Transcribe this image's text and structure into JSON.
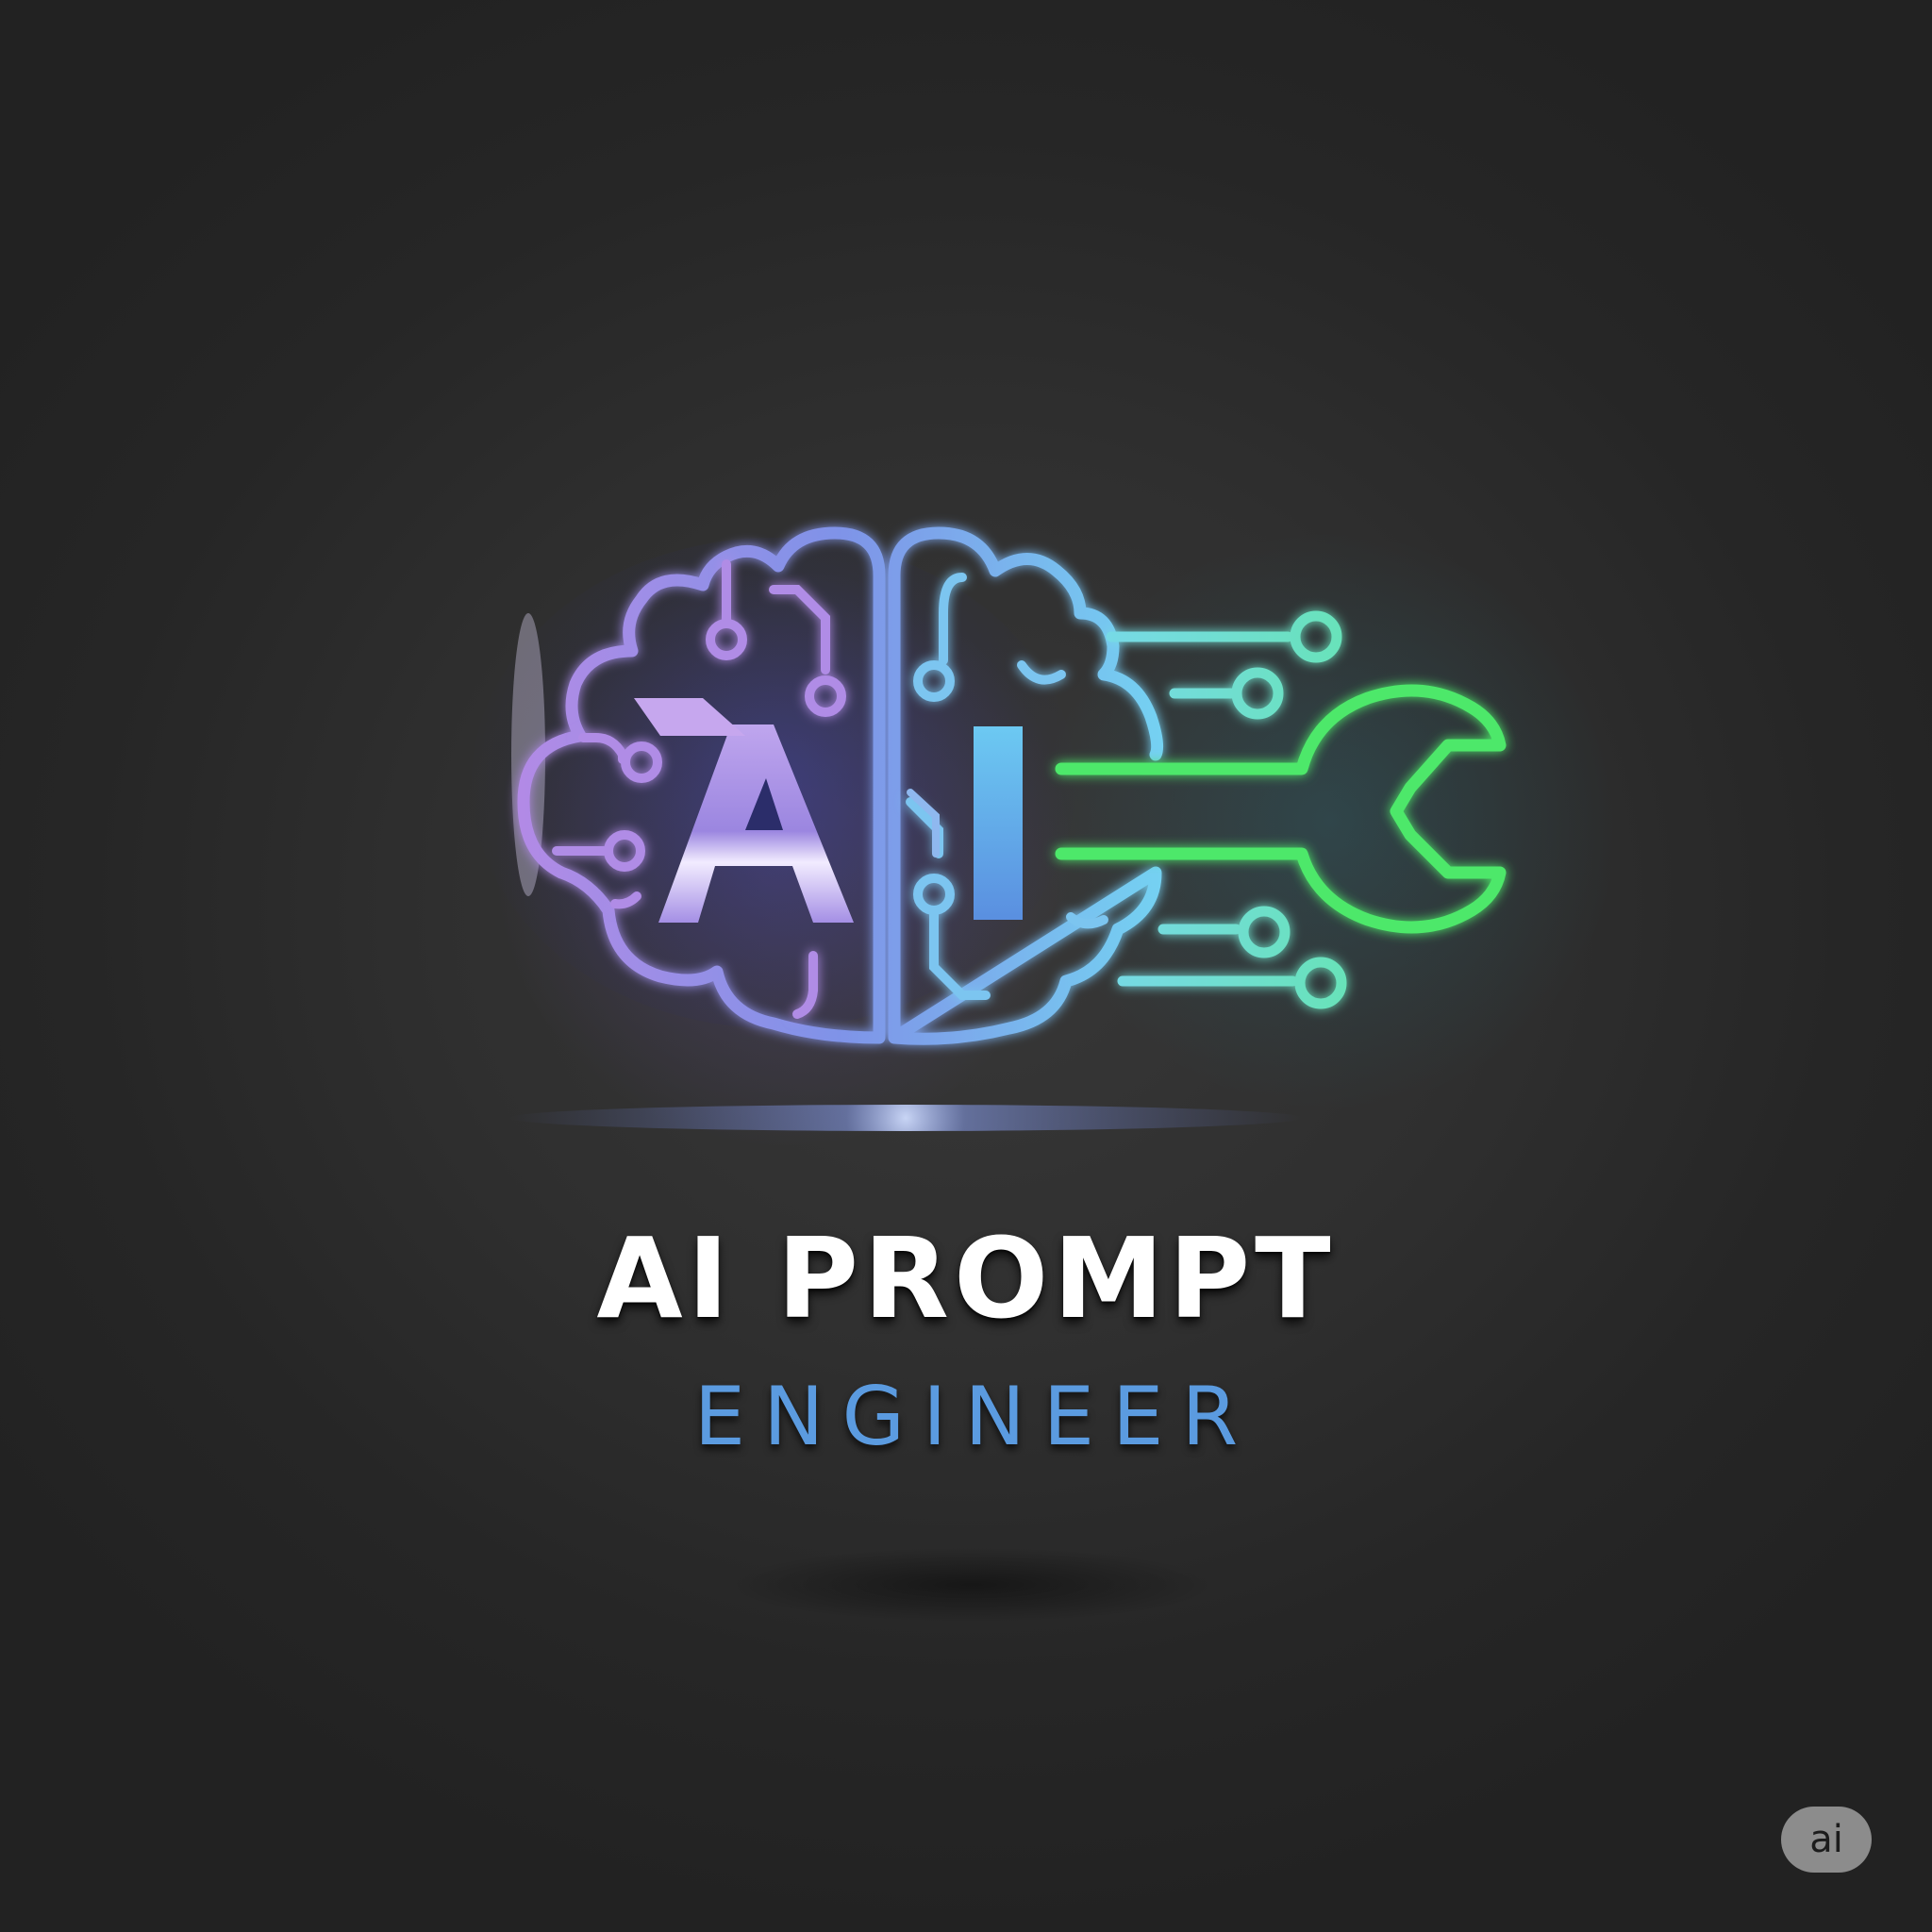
{
  "logo": {
    "emblem_letters": "AI",
    "title": "AI PROMPT",
    "subtitle": "ENGINEER"
  },
  "badge": {
    "label": "ai"
  },
  "icons": {
    "emblem": "brain-circuit-icon",
    "tool": "wrench-icon",
    "badge": "ai-badge-icon"
  },
  "colors": {
    "background": "#262626",
    "brain_left": "#a880e0",
    "brain_right": "#6fc3f0",
    "circuit_lines": "#6ee0c8",
    "wrench": "#4ee86a",
    "title": "#ffffff",
    "subtitle": "#5b9be0"
  }
}
